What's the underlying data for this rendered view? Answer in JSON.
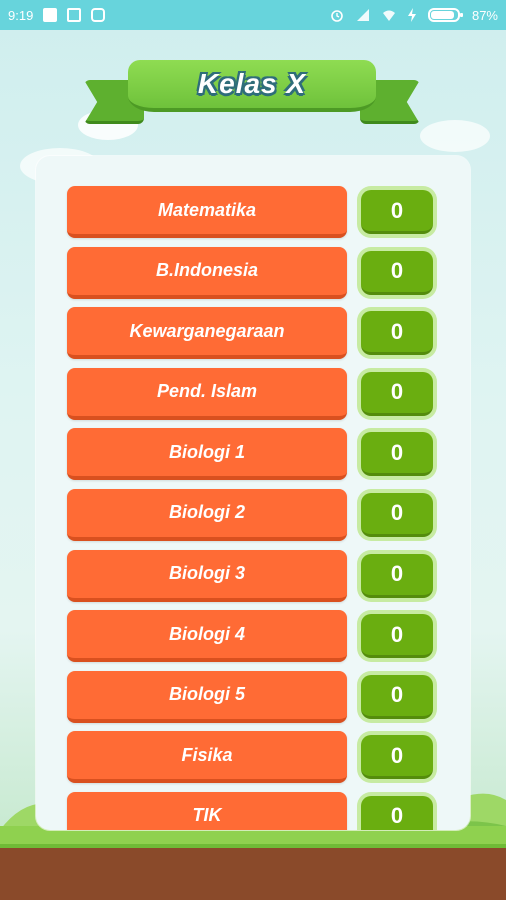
{
  "status_bar": {
    "time": "9:19",
    "battery_percent": "87%",
    "battery_level": 0.87
  },
  "title": "Kelas X",
  "subjects": [
    {
      "name": "Matematika",
      "score": "0"
    },
    {
      "name": "B.Indonesia",
      "score": "0"
    },
    {
      "name": "Kewarganegaraan",
      "score": "0"
    },
    {
      "name": "Pend. Islam",
      "score": "0"
    },
    {
      "name": "Biologi 1",
      "score": "0"
    },
    {
      "name": "Biologi 2",
      "score": "0"
    },
    {
      "name": "Biologi 3",
      "score": "0"
    },
    {
      "name": "Biologi 4",
      "score": "0"
    },
    {
      "name": "Biologi 5",
      "score": "0"
    },
    {
      "name": "Fisika",
      "score": "0"
    },
    {
      "name": "TIK",
      "score": "0"
    }
  ],
  "colors": {
    "subject_button": "#ff6b35",
    "score_badge": "#6aae10",
    "status_bar": "#67d4dc",
    "ribbon": "#7ccd45"
  }
}
